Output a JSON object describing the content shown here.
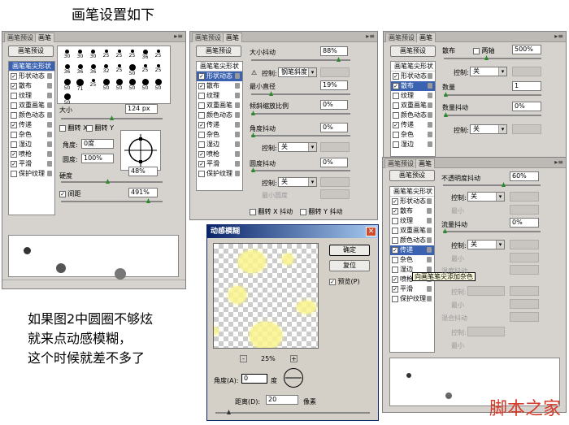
{
  "header": {
    "title": "画笔设置如下"
  },
  "blurb": {
    "lines": [
      "如果图2中圆圈不够炫",
      "就来点动感模糊，",
      "这个时候就差不多了"
    ]
  },
  "panel1": {
    "tabs": [
      "画笔预设",
      "画笔"
    ],
    "preset_button": "画笔预设",
    "list_header": "画笔笔尖形状",
    "items": [
      "形状动态",
      "散布",
      "纹理",
      "双重画笔",
      "颜色动态",
      "传递",
      "杂色",
      "湿边",
      "喷枪",
      "平滑",
      "保护纹理"
    ],
    "brush_sizes": [
      "30",
      "30",
      "30",
      "25",
      "25",
      "25",
      "36",
      "25",
      "36",
      "36",
      "36",
      "32",
      "25",
      "50",
      "25",
      "25",
      "50",
      "71",
      "25",
      "50",
      "50",
      "50",
      "50",
      "50",
      "50"
    ],
    "size_label": "大小",
    "size_value": "124 px",
    "flip_x": "翻转 X",
    "flip_y": "翻转 Y",
    "angle_label": "角度:",
    "angle_value": "0度",
    "round_label": "圆度:",
    "round_value": "100%",
    "hardness_label": "硬度",
    "hardness_value": "48%",
    "spacing_label": "间距",
    "spacing_value": "491%"
  },
  "panel2": {
    "tabs": [
      "画笔预设",
      "画笔"
    ],
    "preset_button": "画笔预设",
    "list_header": "画笔笔尖形状",
    "items": [
      "形状动态",
      "散布",
      "纹理",
      "双重画笔",
      "颜色动态",
      "传递",
      "杂色",
      "湿边",
      "喷枪",
      "平滑",
      "保护纹理"
    ],
    "size_jitter_label": "大小抖动",
    "size_jitter_value": "88%",
    "control_label": "控制:",
    "control_value": "钢笔斜度",
    "min_diameter_label": "最小直径",
    "min_diameter_value": "19%",
    "tilt_scale_label": "倾斜缩放比例",
    "tilt_scale_value": "0%",
    "angle_jitter_label": "角度抖动",
    "angle_jitter_value": "0%",
    "control2_value": "关",
    "round_jitter_label": "圆度抖动",
    "round_jitter_value": "0%",
    "control3_value": "关",
    "min_round_label": "最小圆度",
    "flip_x": "翻转 X 抖动",
    "flip_y": "翻转 Y 抖动"
  },
  "panel3": {
    "tabs": [
      "画笔预设",
      "画笔"
    ],
    "preset_button": "画笔预设",
    "list_header": "画笔笔尖形状",
    "items": [
      "形状动态",
      "散布",
      "纹理",
      "双重画笔",
      "颜色动态",
      "传递",
      "杂色",
      "湿边",
      "喷枪",
      "平滑",
      "保护纹理"
    ],
    "scatter_label": "散布",
    "both_axes": "两轴",
    "scatter_value": "500%",
    "control_label": "控制:",
    "control_value": "关",
    "count_label": "数量",
    "count_value": "1",
    "count_jitter_label": "数量抖动",
    "count_jitter_value": "0%",
    "control2_value": "关"
  },
  "panel4": {
    "tabs": [
      "画笔预设",
      "画笔"
    ],
    "preset_button": "画笔预设",
    "list_header": "画笔笔尖形状",
    "items": [
      "形状动态",
      "散布",
      "纹理",
      "双重画笔",
      "颜色动态",
      "传递",
      "杂色",
      "湿边",
      "喷枪",
      "平滑",
      "保护纹理"
    ],
    "opacity_jitter_label": "不透明度抖动",
    "opacity_jitter_value": "60%",
    "control_label": "控制:",
    "control_value": "关",
    "flow_jitter_label": "流量抖动",
    "flow_jitter_value": "0%",
    "control2_value": "关",
    "tooltip": "向画笔笔尖添加杂色",
    "wetness_label": "湿度抖动",
    "min_label": "最小",
    "mix_label": "混合抖动"
  },
  "dialog": {
    "title": "动感模糊",
    "ok": "确定",
    "reset": "复位",
    "preview_label": "预览(P)",
    "zoom": "25%",
    "angle_label": "角度(A):",
    "angle_value": "0",
    "angle_unit": "度",
    "distance_label": "距离(D):",
    "distance_value": "20",
    "distance_unit": "像素"
  },
  "watermark": {
    "text": "脚本之家"
  }
}
